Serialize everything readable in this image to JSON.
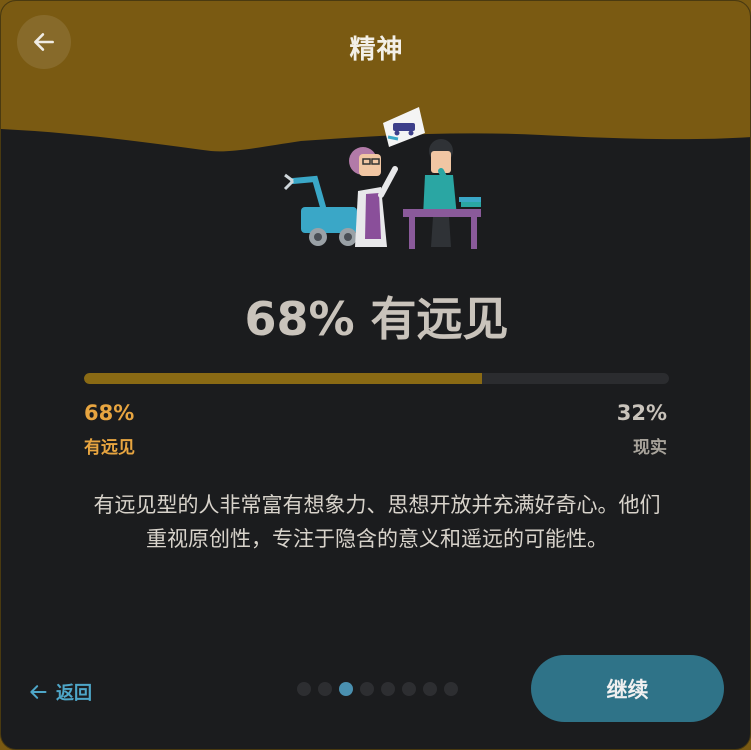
{
  "header": {
    "title": "精神",
    "back_icon": "arrow-left-icon",
    "band_color": "#7a5a12"
  },
  "result": {
    "headline": "68% 有远见",
    "progress_percent": 68,
    "left": {
      "percent": "68%",
      "label": "有远见",
      "color": "#e8a540"
    },
    "right": {
      "percent": "32%",
      "label": "现实"
    },
    "description": "有远见型的人非常富有想象力、思想开放并充满好奇心。他们重视原创性，专注于隐含的意义和遥远的可能性。"
  },
  "footer": {
    "back_label": "返回",
    "back_icon": "arrow-left-icon",
    "continue_label": "继续",
    "dots_total": 8,
    "dots_active_index": 2,
    "accent": "#4ea6c8"
  }
}
